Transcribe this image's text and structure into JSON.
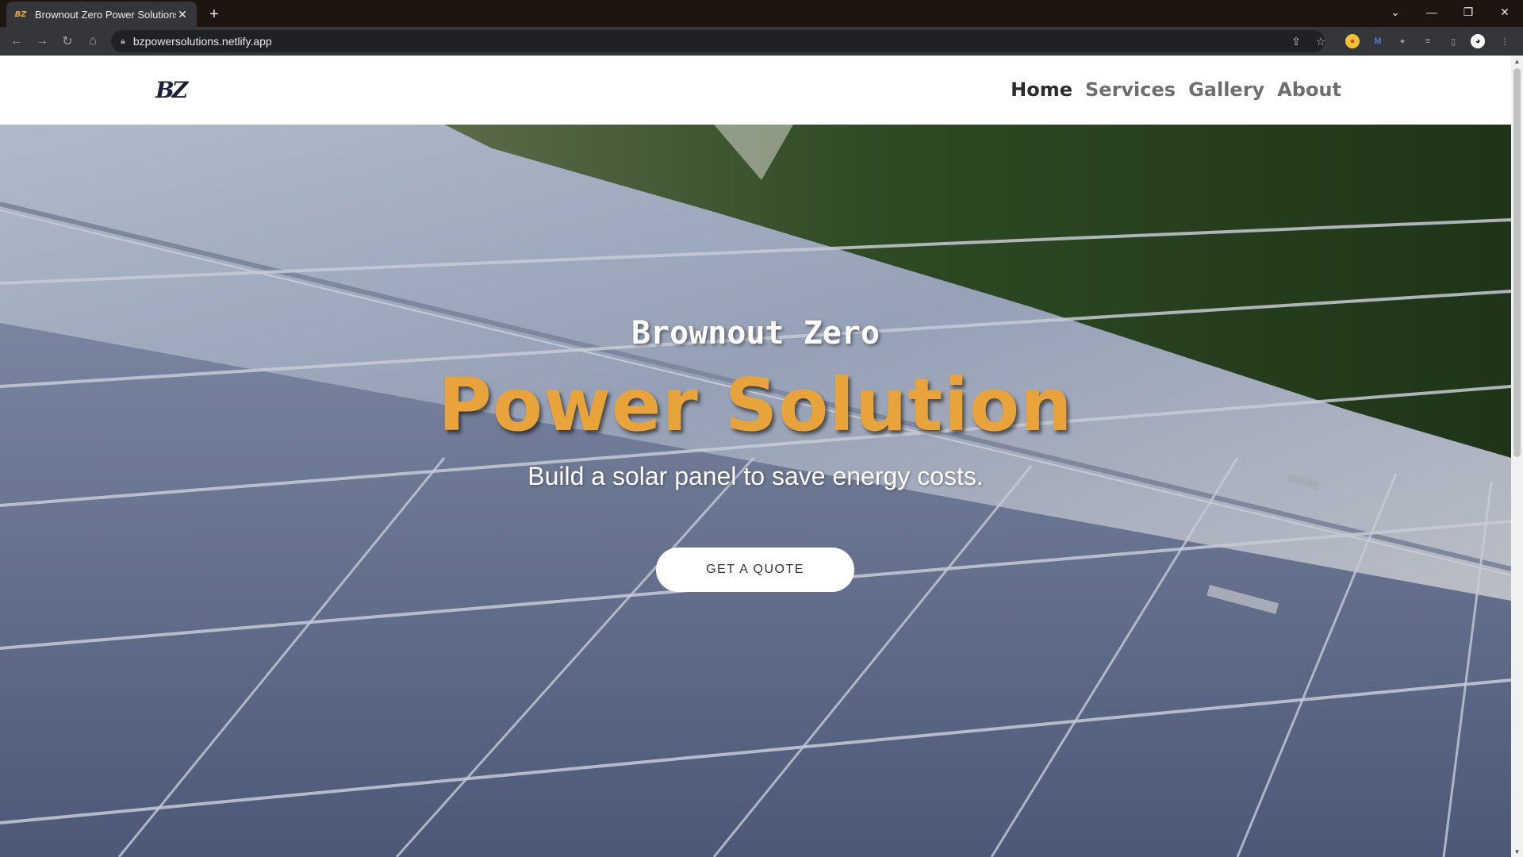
{
  "browser": {
    "tab_title": "Brownout Zero Power Solutions",
    "favicon_text": "BZ",
    "url": "bzpowersolutions.netlify.app"
  },
  "site": {
    "logo_text": "BZ",
    "nav": {
      "home": "Home",
      "services": "Services",
      "gallery": "Gallery",
      "about": "About"
    },
    "hero": {
      "eyebrow": "Brownout Zero",
      "headline": "Power Solution",
      "subline": "Build a solar panel to save energy costs.",
      "cta": "GET A QUOTE"
    }
  },
  "colors": {
    "accent": "#e8a33a",
    "nav_active": "#2b2b2b",
    "nav_inactive": "#6e6e6e"
  },
  "icons": {
    "back": "arrow-left-icon",
    "forward": "arrow-right-icon",
    "reload": "reload-icon",
    "home": "home-icon",
    "lock": "lock-icon",
    "share": "share-icon",
    "bookmark": "star-icon"
  }
}
